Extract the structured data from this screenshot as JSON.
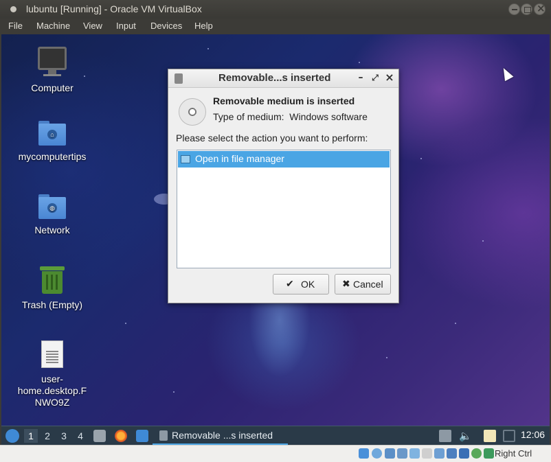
{
  "host_window": {
    "title": "lubuntu [Running] - Oracle VM VirtualBox",
    "menu": [
      "File",
      "Machine",
      "View",
      "Input",
      "Devices",
      "Help"
    ]
  },
  "desktop": {
    "icons": [
      {
        "label": "Computer",
        "icon": "computer-icon"
      },
      {
        "label": "mycomputertips",
        "icon": "home-folder-icon"
      },
      {
        "label": "Network",
        "icon": "network-folder-icon"
      },
      {
        "label": "Trash (Empty)",
        "icon": "trash-icon"
      },
      {
        "label": "user-home.desktop.FNWO9Z",
        "label_lines": [
          "user-",
          "home.desktop.F",
          "NWO9Z"
        ],
        "icon": "text-file-icon"
      }
    ]
  },
  "dialog": {
    "title": "Removable...s inserted",
    "heading": "Removable medium is inserted",
    "type_label": "Type of medium:",
    "type_value": "Windows software",
    "prompt": "Please select the action you want to perform:",
    "actions": [
      "Open in file manager"
    ],
    "selected_action": "Open in file manager",
    "ok_label": "OK",
    "cancel_label": "Cancel"
  },
  "taskbar": {
    "workspaces": [
      "1",
      "2",
      "3",
      "4"
    ],
    "active_workspace": "1",
    "task_label": "Removable ...s inserted",
    "clock": "12:06"
  },
  "status_bar": {
    "host_key": "Right Ctrl"
  },
  "colors": {
    "selection": "#4aa5e4",
    "taskbar": "#2a3a48",
    "host_chrome": "#3c3b37"
  }
}
